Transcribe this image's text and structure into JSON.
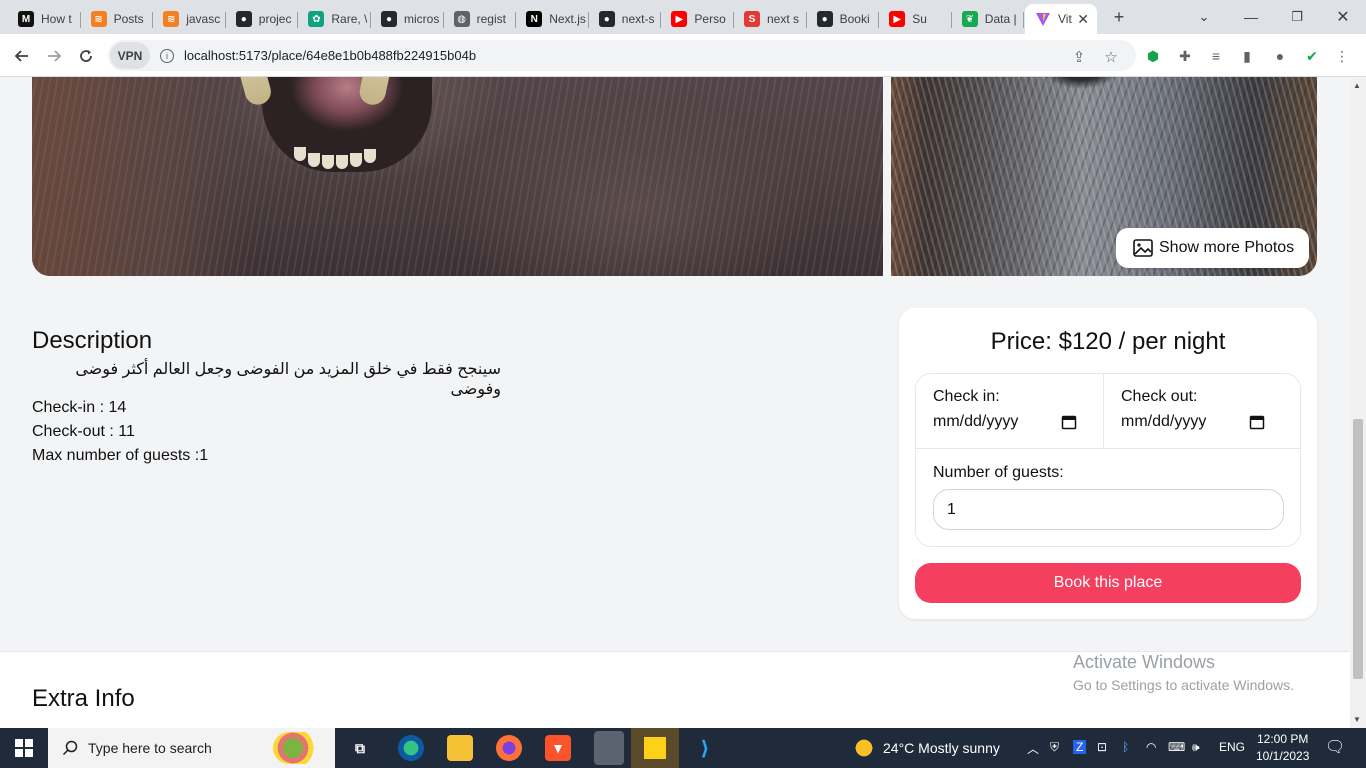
{
  "browser": {
    "tabs": [
      {
        "label": "How t",
        "icon": "gmail-m-icon",
        "color": "#111111"
      },
      {
        "label": "Posts",
        "icon": "stack-icon",
        "color": "#f48024"
      },
      {
        "label": "javasc",
        "icon": "stack-icon",
        "color": "#f48024"
      },
      {
        "label": "projec",
        "icon": "github-icon",
        "color": "#24292f"
      },
      {
        "label": "Rare, \\",
        "icon": "chatgpt-icon",
        "color": "#10a37f"
      },
      {
        "label": "micros",
        "icon": "github-icon",
        "color": "#24292f"
      },
      {
        "label": "regist",
        "icon": "globe-icon",
        "color": "#5f6368"
      },
      {
        "label": "Next.js",
        "icon": "nextjs-icon",
        "color": "#000000"
      },
      {
        "label": "next-s",
        "icon": "github-icon",
        "color": "#24292f"
      },
      {
        "label": "Perso",
        "icon": "youtube-icon",
        "color": "#ff0000"
      },
      {
        "label": "next s",
        "icon": "s-icon",
        "color": "#e53935"
      },
      {
        "label": "Booki",
        "icon": "github-icon",
        "color": "#24292f"
      },
      {
        "label": "Su",
        "icon": "youtube-icon",
        "color": "#ff0000"
      },
      {
        "label": "Data |",
        "icon": "mongodb-icon",
        "color": "#13aa52"
      }
    ],
    "active_tab": {
      "label": "Vit",
      "icon": "vite-icon"
    },
    "url": "localhost:5173/place/64e8e1b0b488fb224915b04b",
    "vpn_label": "VPN"
  },
  "place": {
    "show_more_label": "Show more Photos",
    "description_title": "Description",
    "description": "سينجح فقط في خلق المزيد من الفوضى وجعل العالم أكثر فوضى وفوضى",
    "checkin": "Check-in : 14",
    "checkout": "Check-out : 11",
    "max_guests": "Max number of guests :1",
    "extra_info_title": "Extra Info"
  },
  "booking": {
    "price": "Price: $120 / per night",
    "checkin_label": "Check in:",
    "checkout_label": "Check out:",
    "date_placeholder": "mm/dd/yyyy",
    "guests_label": "Number of guests:",
    "guests_value": "1",
    "book_button": "Book this place",
    "accent": "#f43f5e"
  },
  "watermark": {
    "line1": "Activate Windows",
    "line2": "Go to Settings to activate Windows."
  },
  "taskbar": {
    "search_placeholder": "Type here to search",
    "weather": "24°C  Mostly sunny",
    "language": "ENG",
    "time": "12:00 PM",
    "date": "10/1/2023"
  }
}
